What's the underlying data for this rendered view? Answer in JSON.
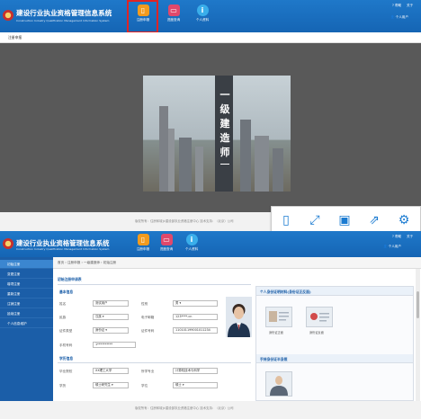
{
  "system": {
    "title": "建设行业执业资格管理信息系统",
    "subtitle": "Construction Industry Qualification Management Information System"
  },
  "nav": [
    {
      "label": "注册申报",
      "icon": "register-icon"
    },
    {
      "label": "进度查询",
      "icon": "progress-query-icon"
    },
    {
      "label": "个人资料",
      "icon": "personal-info-icon"
    }
  ],
  "top_right": {
    "help": "帮助",
    "about": "关于",
    "user": "个人用户"
  },
  "top_right2": {
    "help": "帮助",
    "about": "关于",
    "user": "个人用户"
  },
  "tab1": "注册申报",
  "poster": {
    "text": "一级建造师"
  },
  "footer1": "版权所有：住房和城乡建设部执业资格注册中心    技术支持：（北京）公司",
  "toolbar": [
    {
      "icon": "phone-icon"
    },
    {
      "icon": "fullscreen-icon"
    },
    {
      "icon": "save-icon"
    },
    {
      "icon": "share-icon"
    },
    {
      "icon": "settings-icon"
    }
  ],
  "breadcrumb": {
    "home": "首页",
    "s1": "注册申报",
    "s2": "一级建造师",
    "s3": "初始注册"
  },
  "sidebar": [
    "初始注册",
    "变更注册",
    "增项注册",
    "重新注册",
    "注销注册",
    "延续注册",
    "个人信息维护"
  ],
  "form": {
    "section": "初始注册申请表",
    "basic_title": "基本信息",
    "name_label": "姓名",
    "name": "测试用户",
    "gender_label": "性别",
    "gender": "男",
    "nation_label": "民族",
    "nation": "汉族",
    "email_label": "电子邮箱",
    "email": "123****.cn",
    "idtype_label": "证件类型",
    "idtype": "身份证",
    "idno_label": "证件号码",
    "idno": "110101199001011234",
    "phone_label": "手机号码",
    "phone": "1**********",
    "study_title": "学历信息",
    "school_label": "毕业院校",
    "school": "XX理工大学",
    "major_label": "所学专业",
    "major": "计算机技术与科学",
    "edu_label": "学历",
    "edu": "硕士研究生",
    "degree_label": "学位",
    "degree": "硕士"
  },
  "right": {
    "title": "个人身份证明材料(身份证正反面)",
    "front": "身份证正面",
    "back": "身份证反面",
    "title2": "手持身份证半身照"
  },
  "footer2": "版权所有：住房和城乡建设部执业资格注册中心    技术支持：（北京）公司"
}
